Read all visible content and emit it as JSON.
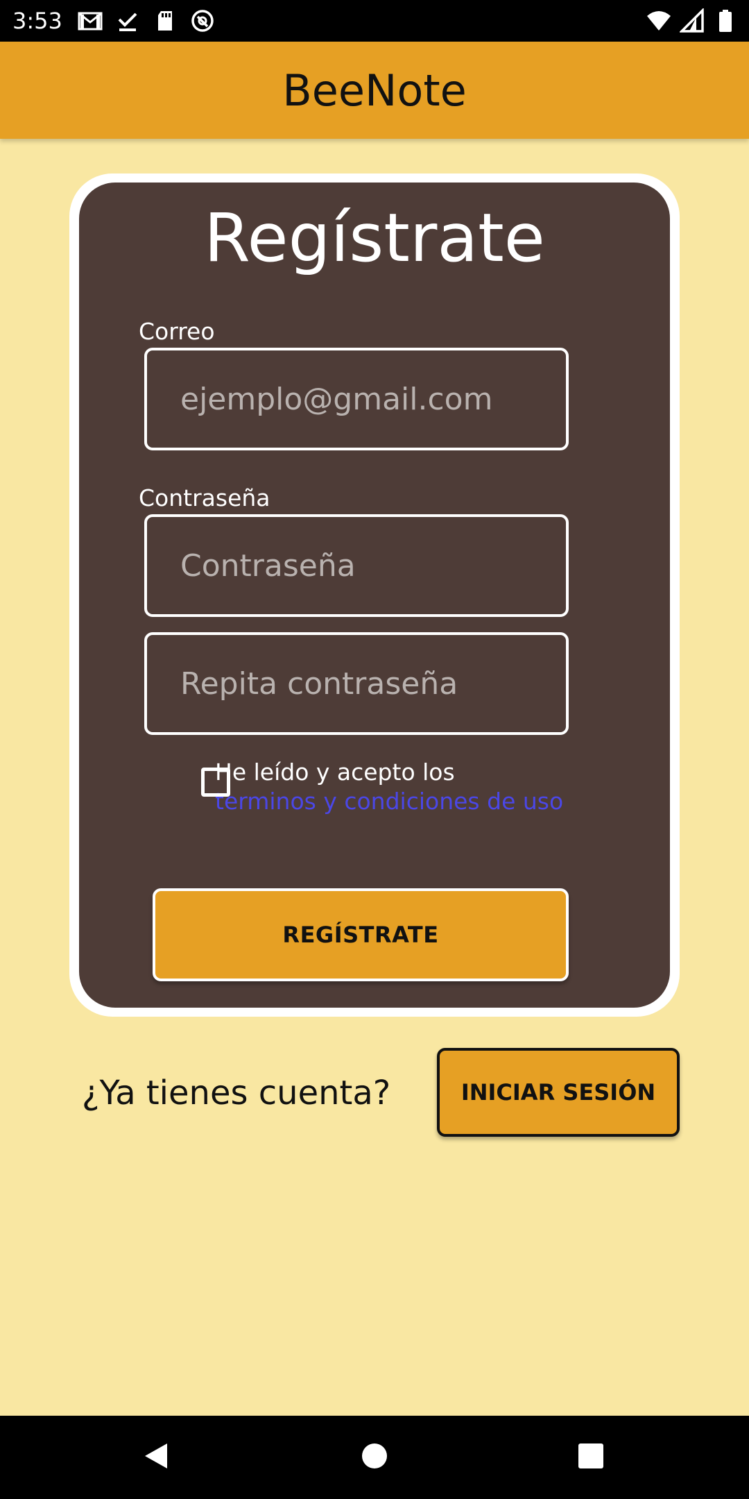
{
  "status_bar": {
    "time": "3:53",
    "icons_left": [
      "gmail-icon",
      "download-done-icon",
      "sd-card-icon",
      "vpn-key-icon"
    ],
    "icons_right": [
      "wifi-icon",
      "signal-icon",
      "battery-icon"
    ]
  },
  "app_bar": {
    "title": "BeeNote"
  },
  "form": {
    "title": "Regístrate",
    "email_label": "Correo",
    "email_placeholder": "ejemplo@gmail.com",
    "email_value": "",
    "password_label": "Contraseña",
    "password_placeholder": "Contraseña",
    "password_value": "",
    "repeat_password_placeholder": "Repita contraseña",
    "repeat_password_value": "",
    "terms_checked": false,
    "terms_text": "He leído y acepto los",
    "terms_link": "terminos y condiciones de uso",
    "register_button": "REGÍSTRATE"
  },
  "footer_prompt": {
    "text": "¿Ya tienes cuenta?",
    "login_button": "INICIAR SESIÓN"
  },
  "nav_bar": {
    "buttons": [
      "back-icon",
      "home-icon",
      "recents-icon"
    ]
  },
  "colors": {
    "background": "#F9E7A2",
    "accent": "#E6A024",
    "card": "#4E3C37",
    "link": "#4B47E6"
  }
}
